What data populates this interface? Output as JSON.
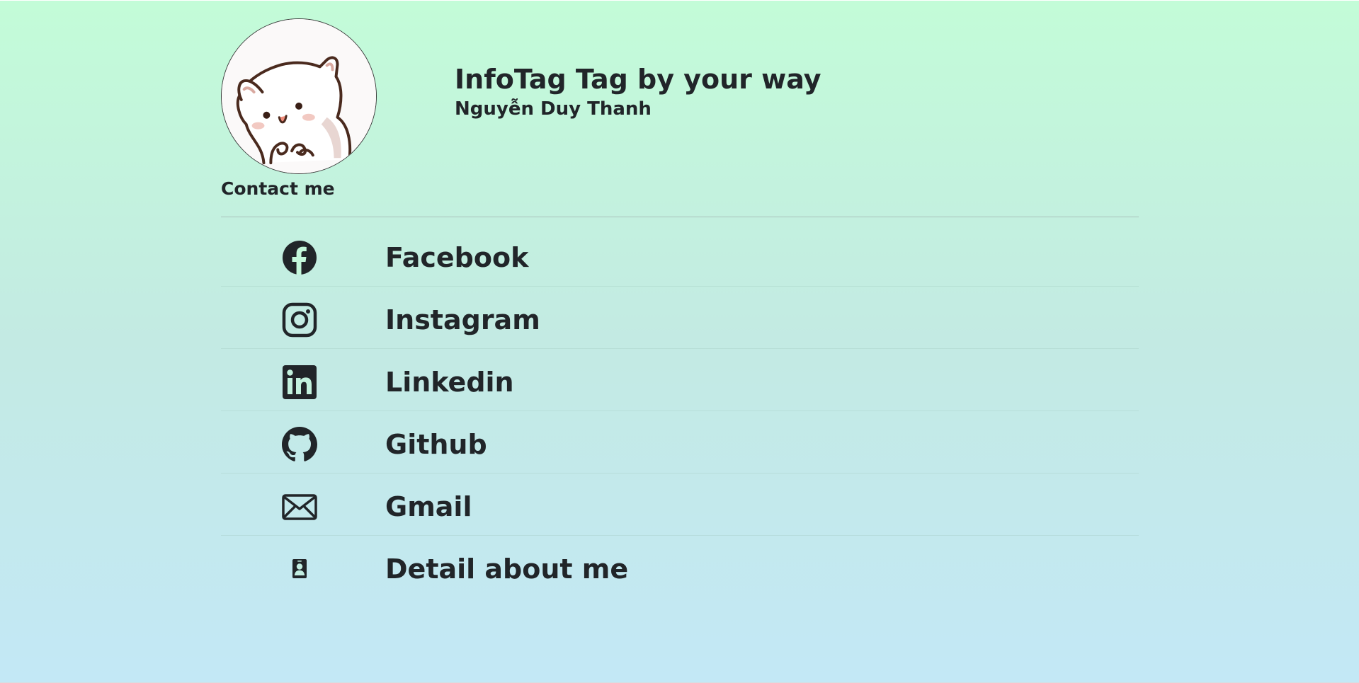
{
  "header": {
    "title": "InfoTag Tag by your way",
    "subtitle": "Nguyễn Duy Thanh",
    "contact_label": "Contact me"
  },
  "links": [
    {
      "label": "Facebook",
      "icon": "facebook-icon"
    },
    {
      "label": "Instagram",
      "icon": "instagram-icon"
    },
    {
      "label": "Linkedin",
      "icon": "linkedin-icon"
    },
    {
      "label": "Github",
      "icon": "github-icon"
    },
    {
      "label": "Gmail",
      "icon": "envelope-icon"
    },
    {
      "label": "Detail about me",
      "icon": "person-badge-icon"
    }
  ],
  "colors": {
    "text": "#212529",
    "gradient_top": "#c3fcd8",
    "gradient_bottom": "#c3e8f6"
  }
}
